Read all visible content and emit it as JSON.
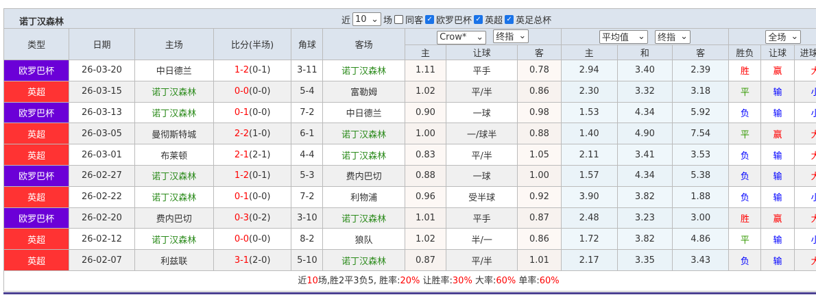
{
  "header": {
    "team": "诺丁汉森林",
    "recent_prefix": "近",
    "recent_value": "10",
    "recent_suffix": "场",
    "filters": [
      {
        "label": "同客",
        "checked": false
      },
      {
        "label": "欧罗巴杯",
        "checked": true
      },
      {
        "label": "英超",
        "checked": true
      },
      {
        "label": "英足总杯",
        "checked": true
      }
    ]
  },
  "columns": {
    "type": "类型",
    "date": "日期",
    "home": "主场",
    "score": "比分(半场)",
    "corner": "角球",
    "away": "客场",
    "company": "Crow*",
    "company_odds": "终指",
    "avg": "平均值",
    "avg_odds": "终指",
    "period": "全场",
    "sub": [
      "主",
      "让球",
      "客",
      "主",
      "和",
      "客",
      "胜负",
      "让球",
      "进球"
    ]
  },
  "colors": {
    "欧罗巴杯": "#6b00d7",
    "英超": "#ff3333",
    "team_highlight": "#2a8a1a",
    "win": "#ff0000",
    "draw": "#339900",
    "loss": "#0000ff"
  },
  "rows": [
    {
      "type": "欧罗巴杯",
      "date": "26-03-20",
      "home": "中日德兰",
      "ft": "1-2",
      "ht": "(0-1)",
      "corner": "3-11",
      "away": "诺丁汉森林",
      "h": "1.11",
      "hc": "平手",
      "a": "0.78",
      "ah": "2.94",
      "ad": "3.40",
      "aa": "2.39",
      "res": "胜",
      "hres": "赢",
      "ou": "大",
      "hl": "away"
    },
    {
      "type": "英超",
      "date": "26-03-15",
      "home": "诺丁汉森林",
      "ft": "0-0",
      "ht": "(0-0)",
      "corner": "5-4",
      "away": "富勒姆",
      "h": "1.02",
      "hc": "平/半",
      "a": "0.86",
      "ah": "2.30",
      "ad": "3.32",
      "aa": "3.18",
      "res": "平",
      "hres": "输",
      "ou": "小",
      "hl": "home"
    },
    {
      "type": "欧罗巴杯",
      "date": "26-03-13",
      "home": "诺丁汉森林",
      "ft": "0-1",
      "ht": "(0-0)",
      "corner": "7-2",
      "away": "中日德兰",
      "h": "0.90",
      "hc": "一球",
      "a": "0.98",
      "ah": "1.53",
      "ad": "4.34",
      "aa": "5.92",
      "res": "负",
      "hres": "输",
      "ou": "小",
      "hl": "home"
    },
    {
      "type": "英超",
      "date": "26-03-05",
      "home": "曼彻斯特城",
      "ft": "2-2",
      "ht": "(1-0)",
      "corner": "6-1",
      "away": "诺丁汉森林",
      "h": "1.00",
      "hc": "一/球半",
      "a": "0.88",
      "ah": "1.40",
      "ad": "4.90",
      "aa": "7.54",
      "res": "平",
      "hres": "赢",
      "ou": "大",
      "hl": "away"
    },
    {
      "type": "英超",
      "date": "26-03-01",
      "home": "布莱顿",
      "ft": "2-1",
      "ht": "(2-1)",
      "corner": "4-4",
      "away": "诺丁汉森林",
      "h": "0.83",
      "hc": "平/半",
      "a": "1.05",
      "ah": "2.11",
      "ad": "3.41",
      "aa": "3.53",
      "res": "负",
      "hres": "输",
      "ou": "大",
      "hl": "away"
    },
    {
      "type": "欧罗巴杯",
      "date": "26-02-27",
      "home": "诺丁汉森林",
      "ft": "1-2",
      "ht": "(0-1)",
      "corner": "5-3",
      "away": "费内巴切",
      "h": "0.88",
      "hc": "一球",
      "a": "1.00",
      "ah": "1.57",
      "ad": "4.34",
      "aa": "5.38",
      "res": "负",
      "hres": "输",
      "ou": "大",
      "hl": "home"
    },
    {
      "type": "英超",
      "date": "26-02-22",
      "home": "诺丁汉森林",
      "ft": "0-1",
      "ht": "(0-0)",
      "corner": "7-2",
      "away": "利物浦",
      "h": "0.96",
      "hc": "受半球",
      "a": "0.92",
      "ah": "3.90",
      "ad": "3.82",
      "aa": "1.88",
      "res": "负",
      "hres": "输",
      "ou": "小",
      "hl": "home"
    },
    {
      "type": "欧罗巴杯",
      "date": "26-02-20",
      "home": "费内巴切",
      "ft": "0-3",
      "ht": "(0-2)",
      "corner": "3-10",
      "away": "诺丁汉森林",
      "h": "1.01",
      "hc": "平手",
      "a": "0.87",
      "ah": "2.48",
      "ad": "3.23",
      "aa": "3.00",
      "res": "胜",
      "hres": "赢",
      "ou": "大",
      "hl": "away"
    },
    {
      "type": "英超",
      "date": "26-02-12",
      "home": "诺丁汉森林",
      "ft": "0-0",
      "ht": "(0-0)",
      "corner": "8-2",
      "away": "狼队",
      "h": "1.02",
      "hc": "半/一",
      "a": "0.86",
      "ah": "1.72",
      "ad": "3.82",
      "aa": "4.86",
      "res": "平",
      "hres": "输",
      "ou": "小",
      "hl": "home"
    },
    {
      "type": "英超",
      "date": "26-02-07",
      "home": "利兹联",
      "ft": "3-1",
      "ht": "(2-0)",
      "corner": "5-10",
      "away": "诺丁汉森林",
      "h": "0.87",
      "hc": "平/半",
      "a": "1.01",
      "ah": "2.17",
      "ad": "3.35",
      "aa": "3.43",
      "res": "负",
      "hres": "输",
      "ou": "大",
      "hl": "away"
    }
  ],
  "summary": {
    "p1": "近",
    "n": "10",
    "p2": "场,胜2平3负5, 胜率:",
    "win": "20%",
    "p3": " 让胜率:",
    "hwin": "30%",
    "p4": " 大率:",
    "big": "60%",
    "p5": " 单率:",
    "odd": "60%"
  }
}
